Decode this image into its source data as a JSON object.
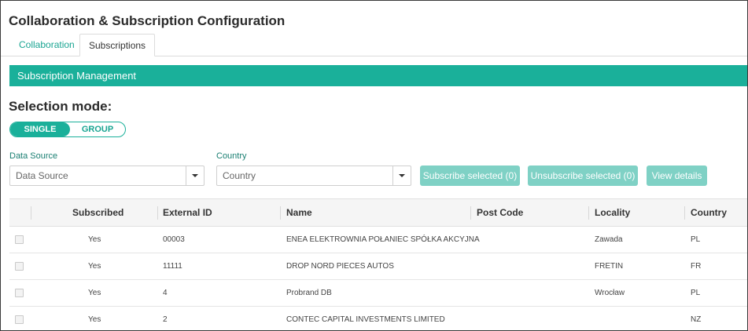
{
  "page": {
    "title": "Collaboration & Subscription Configuration"
  },
  "tabs": [
    {
      "label": "Collaboration",
      "active": false
    },
    {
      "label": "Subscriptions",
      "active": true
    }
  ],
  "section": {
    "title": "Subscription Management"
  },
  "selection": {
    "label": "Selection mode:",
    "options": [
      "SINGLE",
      "GROUP"
    ],
    "selected": "SINGLE"
  },
  "filters": {
    "data_source": {
      "label": "Data Source",
      "placeholder": "Data Source"
    },
    "country": {
      "label": "Country",
      "placeholder": "Country"
    }
  },
  "actions": {
    "subscribe": "Subscribe selected (0)",
    "unsubscribe": "Unsubscribe selected (0)",
    "view_details": "View details"
  },
  "colors": {
    "accent": "#1ab09a",
    "accent_light": "#7fd1c5",
    "link": "#1aa592"
  },
  "icons": {
    "dropdown": "chevron-down-icon"
  },
  "table": {
    "columns": [
      "Subscribed",
      "External ID",
      "Name",
      "Post Code",
      "Locality",
      "Country"
    ],
    "rows": [
      {
        "subscribed": "Yes",
        "external_id": "00003",
        "name": "ENEA ELEKTROWNIA POŁANIEC SPÓŁKA AKCYJNA",
        "post_code": "",
        "locality": "Zawada",
        "country": "PL"
      },
      {
        "subscribed": "Yes",
        "external_id": "11111",
        "name": "DROP NORD PIECES AUTOS",
        "post_code": "",
        "locality": "FRETIN",
        "country": "FR"
      },
      {
        "subscribed": "Yes",
        "external_id": "4",
        "name": "Probrand DB",
        "post_code": "",
        "locality": "Wrocław",
        "country": "PL"
      },
      {
        "subscribed": "Yes",
        "external_id": "2",
        "name": "CONTEC CAPITAL INVESTMENTS LIMITED",
        "post_code": "",
        "locality": "",
        "country": "NZ"
      }
    ]
  }
}
